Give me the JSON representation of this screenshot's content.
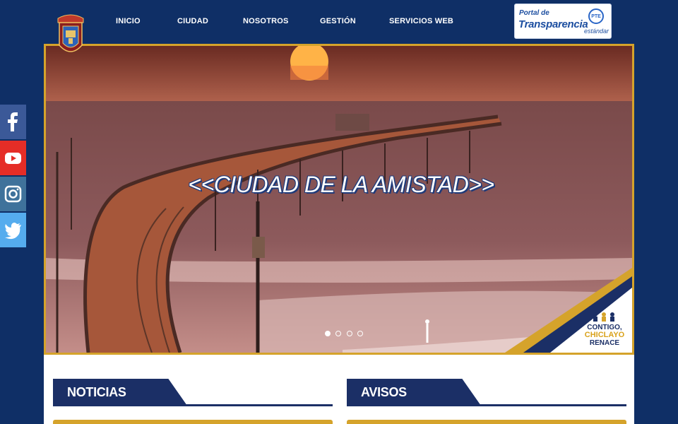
{
  "header": {
    "crest_icon": "municipal-crest-icon",
    "nav": [
      {
        "label": "INICIO"
      },
      {
        "label": "CIUDAD"
      },
      {
        "label": "NOSOTROS"
      },
      {
        "label": "GESTIÓN"
      },
      {
        "label": "SERVICIOS WEB"
      }
    ],
    "portal": {
      "line1": "Portal de",
      "line2": "Transparencia",
      "badge": "PTE",
      "line3": "estándar"
    }
  },
  "social": [
    {
      "icon": "facebook-icon",
      "color": "#3b5998"
    },
    {
      "icon": "youtube-icon",
      "color": "#e52d27"
    },
    {
      "icon": "instagram-icon",
      "color": "#3f729b"
    },
    {
      "icon": "twitter-icon",
      "color": "#55acee"
    }
  ],
  "hero": {
    "title": "<<CIUDAD DE LA AMISTAD>>",
    "slides": 4,
    "active_slide": 1,
    "brand": {
      "line1": "CONTIGO,",
      "line2": "CHICLAYO",
      "line3": "RENACE"
    }
  },
  "sections": [
    {
      "title": "NOTICIAS"
    },
    {
      "title": "AVISOS"
    }
  ],
  "colors": {
    "background": "#0f2f66",
    "accent_gold": "#d5a32b",
    "section_navy": "#1b2f66"
  }
}
